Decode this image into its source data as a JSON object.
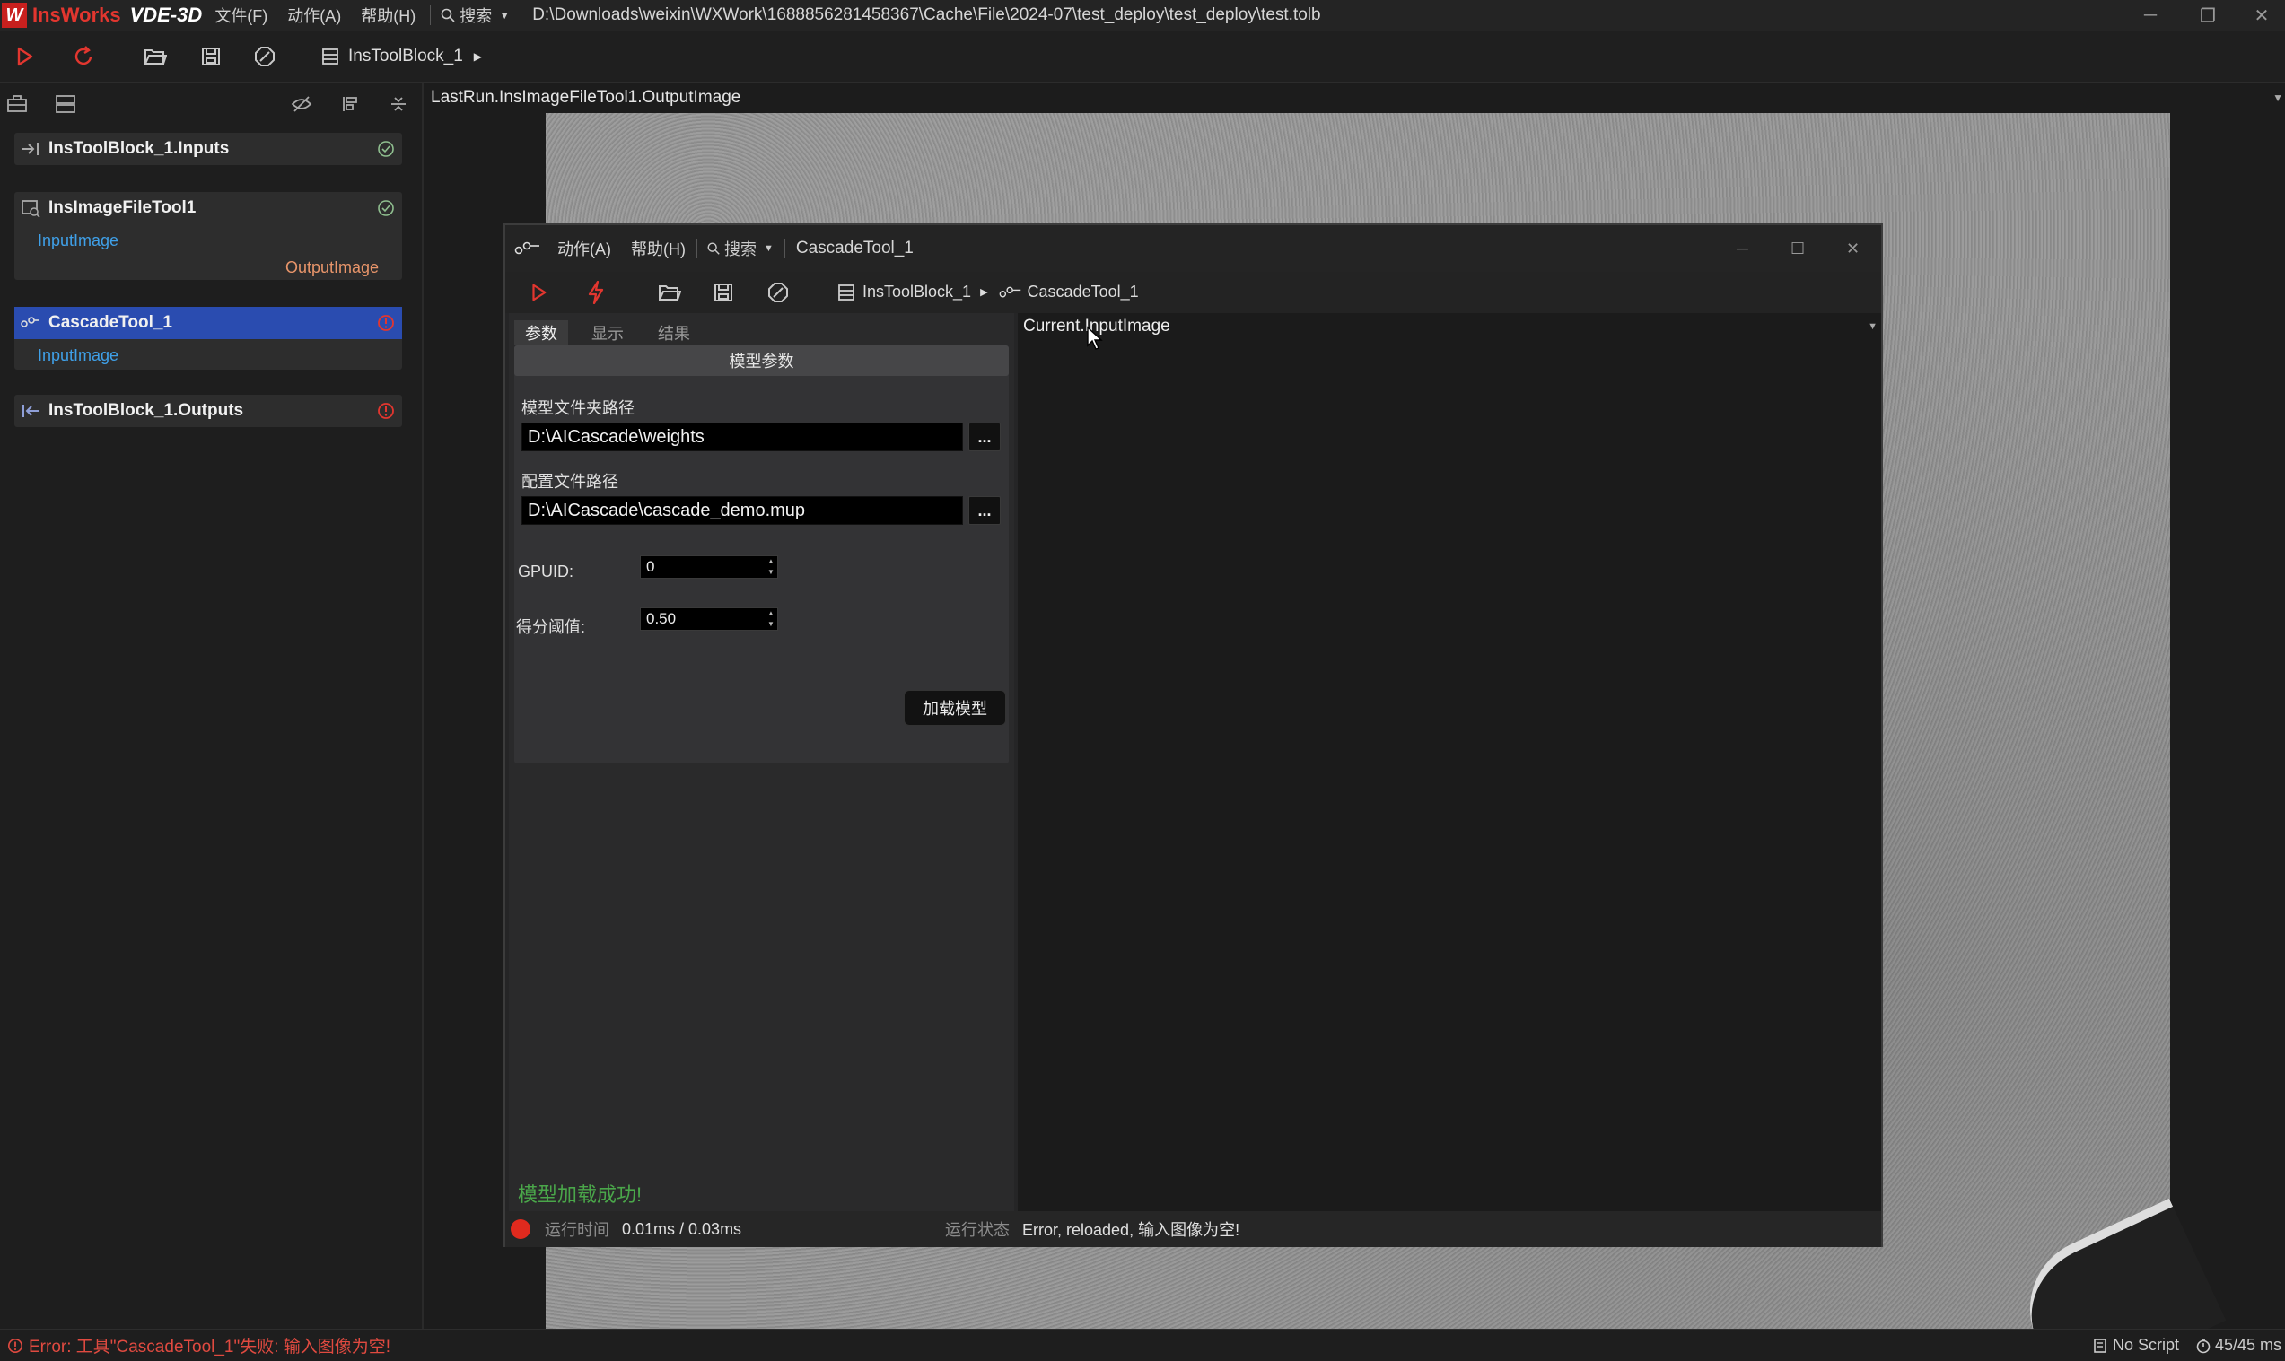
{
  "app": {
    "logo_letter": "W",
    "brand": "InsWorks",
    "product": "VDE-3D",
    "menus": [
      "文件(F)",
      "动作(A)",
      "帮助(H)"
    ],
    "search_label": "搜索",
    "file_path": "D:\\Downloads\\weixin\\WXWork\\1688856281458367\\Cache\\File\\2024-07\\test_deploy\\test_deploy\\test.tolb"
  },
  "toolbar": {
    "breadcrumb": "InsToolBlock_1"
  },
  "left_panel": {
    "nodes": [
      {
        "name": "InsToolBlock_1.Inputs",
        "status": "ok"
      },
      {
        "name": "InsImageFileTool1",
        "status": "ok",
        "input": "InputImage",
        "output": "OutputImage"
      },
      {
        "name": "CascadeTool_1",
        "status": "error",
        "input": "InputImage"
      },
      {
        "name": "InsToolBlock_1.Outputs",
        "status": "error"
      }
    ]
  },
  "view": {
    "header": "LastRun.InsImageFileTool1.OutputImage"
  },
  "dialog": {
    "menus": [
      "动作(A)",
      "帮助(H)"
    ],
    "search_label": "搜索",
    "title": "CascadeTool_1",
    "breadcrumb": [
      "InsToolBlock_1",
      "CascadeTool_1"
    ],
    "tabs": [
      "参数",
      "显示",
      "结果"
    ],
    "section_header": "模型参数",
    "model_dir_label": "模型文件夹路径",
    "model_dir_value": "D:\\AICascade\\weights",
    "config_label": "配置文件路径",
    "config_value": "D:\\AICascade\\cascade_demo.mup",
    "browse_label": "...",
    "gpuid_label": "GPUID:",
    "gpuid_value": "0",
    "score_label": "得分阈值:",
    "score_value": "0.50",
    "load_button": "加载模型",
    "load_message": "模型加载成功!",
    "right_header": "Current.InputImage",
    "status": {
      "runtime_label": "运行时间",
      "runtime_value": "0.01ms / 0.03ms",
      "state_label": "运行状态",
      "state_value": "Error, reloaded, 输入图像为空!"
    }
  },
  "statusbar": {
    "error": "Error: 工具\"CascadeTool_1\"失败: 输入图像为空!",
    "script": "No Script",
    "timing": "45/45 ms"
  },
  "colors": {
    "accent_red": "#e2362f",
    "selected_blue": "#2a4cb0",
    "input_port": "#3fa0e8",
    "output_port": "#e8956a",
    "ok_green": "#8fbf8f",
    "success_text": "#4aa64a"
  },
  "icons": [
    "run-icon",
    "refresh-icon",
    "folder-open-icon",
    "save-icon",
    "hexagon-icon",
    "list-icon",
    "lightning-icon",
    "search-icon"
  ]
}
